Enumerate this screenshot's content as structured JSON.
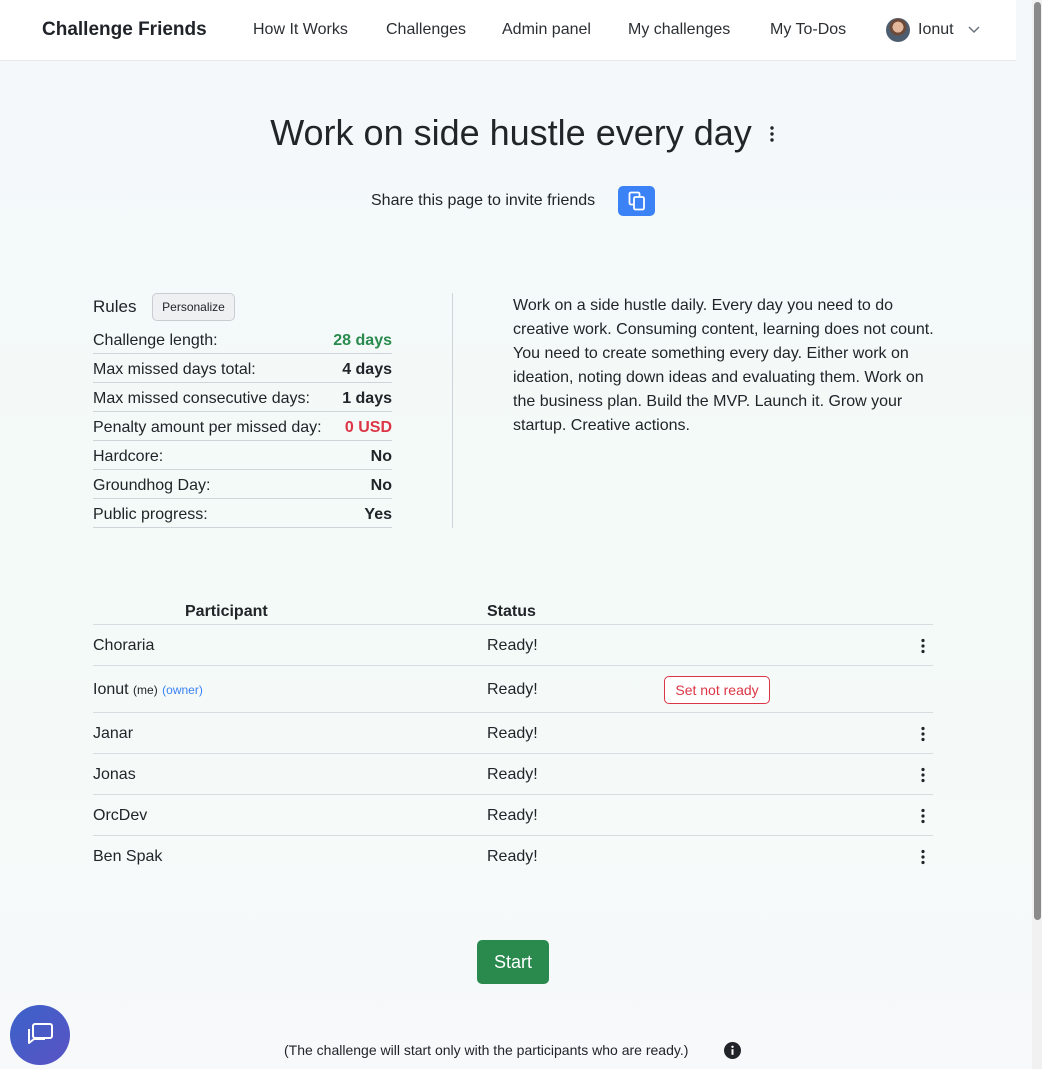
{
  "navbar": {
    "brand": "Challenge Friends",
    "links": [
      "How It Works",
      "Challenges",
      "Admin panel",
      "My challenges",
      "My To-Dos"
    ],
    "user_name": "Ionut"
  },
  "challenge": {
    "title": "Work on side hustle every day",
    "share_text": "Share this page to invite friends"
  },
  "rules": {
    "heading": "Rules",
    "personalize_label": "Personalize",
    "items": [
      {
        "label": "Challenge length:",
        "value": "28 days"
      },
      {
        "label": "Max missed days total:",
        "value": "4 days"
      },
      {
        "label": "Max missed consecutive days:",
        "value": "1 days"
      },
      {
        "label": "Penalty amount per missed day:",
        "value": "0 USD"
      },
      {
        "label": "Hardcore:",
        "value": "No"
      },
      {
        "label": "Groundhog Day:",
        "value": "No"
      },
      {
        "label": "Public progress:",
        "value": "Yes"
      }
    ]
  },
  "description": "Work on a side hustle daily. Every day you need to do creative work. Consuming content, learning does not count. You need to create something every day. Either work on ideation, noting down ideas and evaluating them. Work on the business plan. Build the MVP. Launch it. Grow your startup. Creative actions.",
  "participants": {
    "headers": {
      "participant": "Participant",
      "status": "Status"
    },
    "me_tag": "(me)",
    "owner_tag": "(owner)",
    "set_not_ready_label": "Set not ready",
    "rows": [
      {
        "name": "Choraria",
        "status": "Ready!"
      },
      {
        "name": "Ionut",
        "status": "Ready!"
      },
      {
        "name": "Janar",
        "status": "Ready!"
      },
      {
        "name": "Jonas",
        "status": "Ready!"
      },
      {
        "name": "OrcDev",
        "status": "Ready!"
      },
      {
        "name": "Ben Spak",
        "status": "Ready!"
      }
    ]
  },
  "start_label": "Start",
  "note": "(The challenge will start only with the participants who are ready.)",
  "colors": {
    "success": "#2a8a4e",
    "danger": "#dc3545",
    "primary": "#3b82f6"
  }
}
